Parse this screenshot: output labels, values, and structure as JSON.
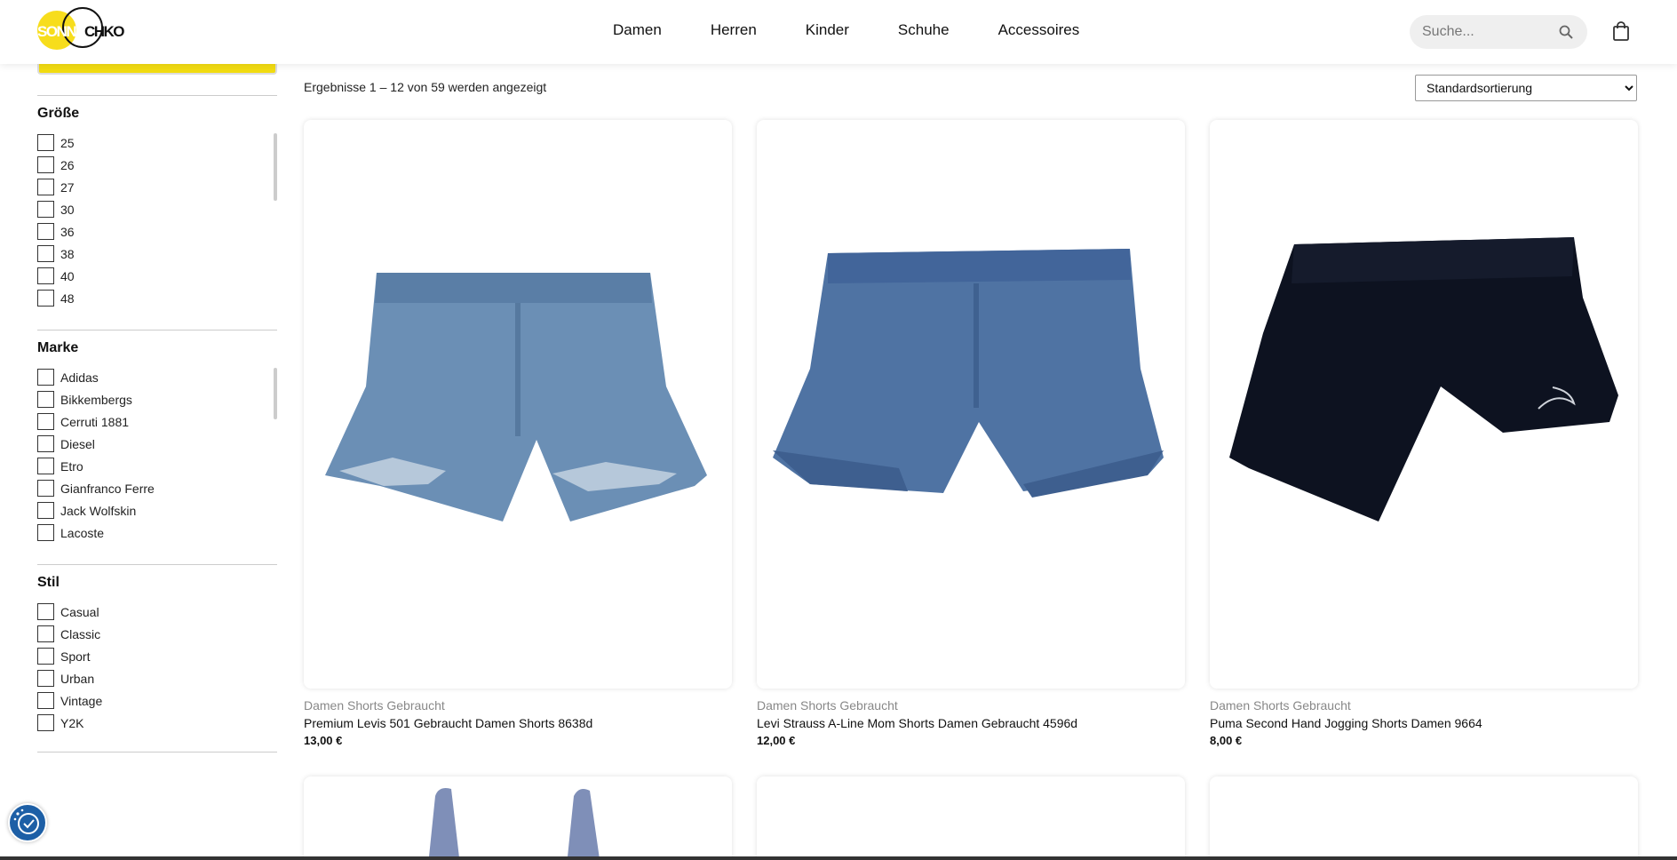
{
  "brand": {
    "logo_part1": "SONNE",
    "logo_part2": "CHKO"
  },
  "nav": [
    "Damen",
    "Herren",
    "Kinder",
    "Schuhe",
    "Accessoires"
  ],
  "search": {
    "placeholder": "Suche..."
  },
  "filters": {
    "size": {
      "title": "Größe",
      "items": [
        "25",
        "26",
        "27",
        "30",
        "36",
        "38",
        "40",
        "48"
      ]
    },
    "brand": {
      "title": "Marke",
      "items": [
        "Adidas",
        "Bikkembergs",
        "Cerruti 1881",
        "Diesel",
        "Etro",
        "Gianfranco Ferre",
        "Jack Wolfskin",
        "Lacoste"
      ]
    },
    "style": {
      "title": "Stil",
      "items": [
        "Casual",
        "Classic",
        "Sport",
        "Urban",
        "Vintage",
        "Y2K"
      ]
    }
  },
  "results_text": "Ergebnisse 1 – 12 von 59 werden angezeigt",
  "sort": {
    "selected": "Standardsortierung"
  },
  "products": [
    {
      "category": "Damen Shorts Gebraucht",
      "title": "Premium Levis 501 Gebraucht Damen Shorts 8638d",
      "price": "13,00 €",
      "color": "#6b8fb5"
    },
    {
      "category": "Damen Shorts Gebraucht",
      "title": "Levi Strauss A-Line Mom Shorts Damen Gebraucht 4596d",
      "price": "12,00 €",
      "color": "#4f73a3"
    },
    {
      "category": "Damen Shorts Gebraucht",
      "title": "Puma Second Hand Jogging Shorts Damen 9664",
      "price": "8,00 €",
      "color": "#0d1220"
    }
  ],
  "colors": {
    "accent_yellow": "#f2dc12",
    "cookie_blue": "#1d5fa6"
  }
}
